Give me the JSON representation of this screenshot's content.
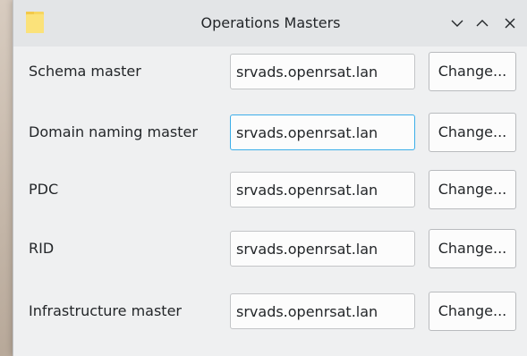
{
  "window": {
    "title": "Operations Masters",
    "icon": "folder-icon",
    "controls": [
      "chevron-down-icon",
      "chevron-up-icon",
      "close-icon"
    ]
  },
  "masters": [
    {
      "label": "Schema master",
      "value": "srvads.openrsat.lan",
      "button": "Change...",
      "focused": false
    },
    {
      "label": "Domain naming master",
      "value": "srvads.openrsat.lan",
      "button": "Change...",
      "focused": true
    },
    {
      "label": "PDC",
      "value": "srvads.openrsat.lan",
      "button": "Change...",
      "focused": false
    },
    {
      "label": "RID",
      "value": "srvads.openrsat.lan",
      "button": "Change...",
      "focused": false
    },
    {
      "label": "Infrastructure master",
      "value": "srvads.openrsat.lan",
      "button": "Change...",
      "focused": false
    }
  ],
  "colors": {
    "focus_border": "#3daee9",
    "window_bg": "#eff0f1",
    "titlebar_bg": "#e3e5e7"
  }
}
